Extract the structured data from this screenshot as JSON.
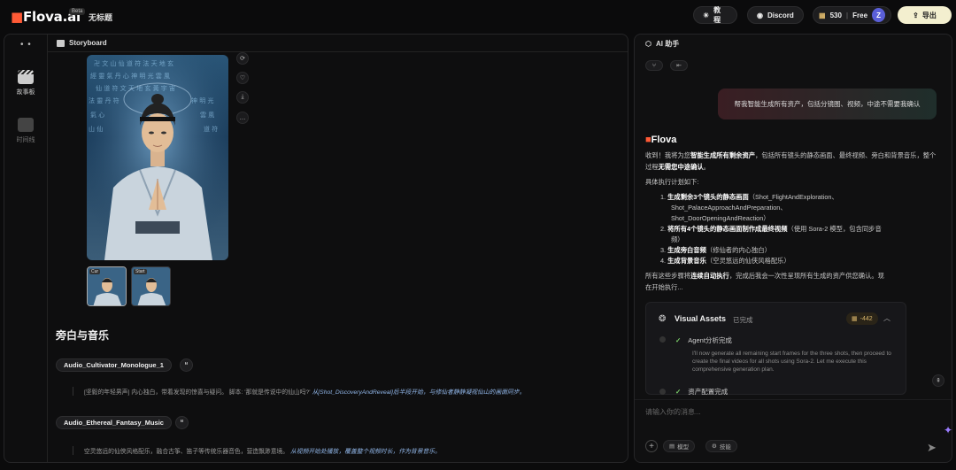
{
  "app": {
    "logo": "Flova.ai",
    "logo_mark": "■",
    "beta": "Beta",
    "project_title": "无标题"
  },
  "topbar": {
    "tutorial": "教程",
    "discord": "Discord",
    "credits": "530",
    "plan": "Free",
    "avatar": "Z",
    "export": "导出"
  },
  "left": {
    "panel_title": "Storyboard",
    "rail": [
      {
        "label": "故事板"
      },
      {
        "label": "时间线"
      }
    ],
    "thumb_tags": [
      "Cur",
      "Start"
    ],
    "section_title": "旁白与音乐",
    "audio": [
      {
        "name": "Audio_Cultivator_Monologue_1",
        "quote": "“",
        "text": "[坚毅的年轻男声] 内心独白，带着发现的惊喜与疑问。 脚本: '那就是传说中的仙山吗?' ",
        "text_italic": "从[Shot_DiscoveryAndReveal]后半段开始，与修仙者静静凝视仙山的画面同步。"
      },
      {
        "name": "Audio_Ethereal_Fantasy_Music",
        "quote": "“",
        "text": "空灵悠远的仙侠风格配乐，融合古筝、笛子等传统乐器音色，营造飘渺意境。 ",
        "text_italic": "从视频开始处播放，覆盖整个视频时长，作为背景音乐。"
      }
    ]
  },
  "right": {
    "panel_title": "AI 助手",
    "user_message": "帮我智能生成所有资产，包括分镜图、视频，中途不需要我确认",
    "bot_name": "Flova",
    "intro_1": "收到！我将为您",
    "intro_b1": "智能生成所有剩余资产",
    "intro_2": "，包括所有镜头的静态画面、最终视频、旁白和背景音乐，整个过程",
    "intro_b2": "无需您中途确认",
    "intro_3": "。",
    "plan_heading": "具体执行计划如下:",
    "steps": [
      {
        "num": "1.",
        "bold": "生成剩余3个镜头的静态画面",
        "rest": "（Shot_FlightAndExploration、",
        "line2": "Shot_PalaceApproachAndPreparation、",
        "line3": "Shot_DoorOpeningAndReaction）"
      },
      {
        "num": "2.",
        "bold": "将所有4个镜头的静态画面制作成最终视频",
        "rest": "（使用 Sora-2 模型，包含同步音",
        "line2": "频）"
      },
      {
        "num": "3.",
        "bold": "生成旁白音频",
        "rest": "（修仙者的内心独白）"
      },
      {
        "num": "4.",
        "bold": "生成背景音乐",
        "rest": "（空灵悠远的仙侠风格配乐）"
      }
    ],
    "outro_1": "所有这些步骤将",
    "outro_b": "连续自动执行",
    "outro_2": "，完成后我会一次性呈现所有生成的资产供您确认。现",
    "outro_3": "在开始执行...",
    "assets": {
      "title": "Visual Assets",
      "status": "已完成",
      "cost": "-442",
      "step1": "Agent分析完成",
      "desc": "I'll now generate all remaining start frames for the three shots, then proceed to create the final videos for all shots using Sora-2. Let me execute this comprehensive generation plan.",
      "step2": "资产配置完成"
    },
    "input_placeholder": "请输入你的消息...",
    "tool_model": "模型",
    "tool_skill": "技能"
  },
  "colors": {
    "accent": "#ff5a36",
    "export_bg": "#f3efcf",
    "avatar": "#5a5fd8",
    "check": "#7bcf6a"
  }
}
